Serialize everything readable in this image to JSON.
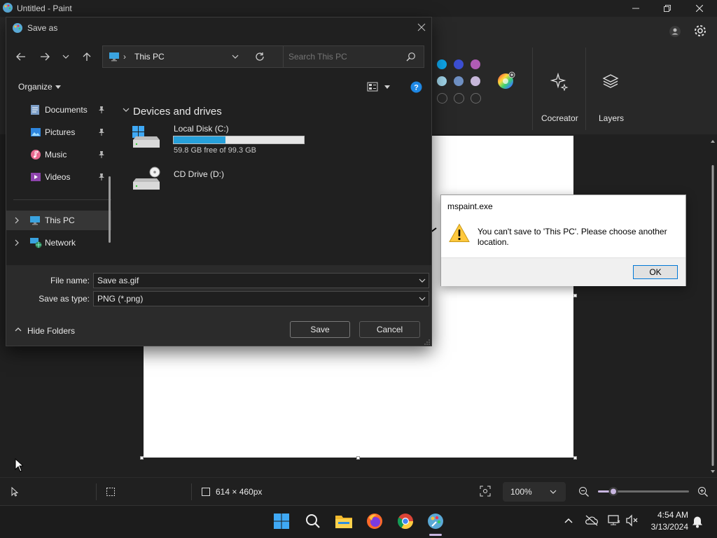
{
  "paint": {
    "title": "Untitled - Paint",
    "ribbon": {
      "cocreator_label": "Cocreator",
      "layers_label": "Layers",
      "colors": [
        "#0ea5e9",
        "#3b4ed1",
        "#b05cb5",
        "#9fd3e8",
        "#6e8fc2",
        "#c6b6d9"
      ]
    },
    "status": {
      "canvas_size": "614 × 460px",
      "zoom": "100%"
    }
  },
  "saveas": {
    "title": "Save as",
    "address": {
      "location": "This PC"
    },
    "search": {
      "placeholder": "Search This PC"
    },
    "organize_label": "Organize",
    "nav": {
      "items": [
        {
          "label": "Documents"
        },
        {
          "label": "Pictures"
        },
        {
          "label": "Music"
        },
        {
          "label": "Videos"
        },
        {
          "label": "This PC"
        },
        {
          "label": "Network"
        }
      ]
    },
    "content": {
      "group_header": "Devices and drives",
      "drives": [
        {
          "name": "Local Disk (C:)",
          "free_text": "59.8 GB free of 99.3 GB",
          "used_fraction": 0.398
        },
        {
          "name": "CD Drive (D:)"
        }
      ]
    },
    "filename_label": "File name:",
    "filename_value": "Save as.gif",
    "savetype_label": "Save as type:",
    "savetype_value": "PNG (*.png)",
    "hide_folders_label": "Hide Folders",
    "save_button": "Save",
    "cancel_button": "Cancel"
  },
  "msgbox": {
    "title": "mspaint.exe",
    "message": "You can't save to 'This PC'. Please choose another location.",
    "ok_button": "OK"
  },
  "taskbar": {
    "time": "4:54 AM",
    "date": "3/13/2024"
  }
}
